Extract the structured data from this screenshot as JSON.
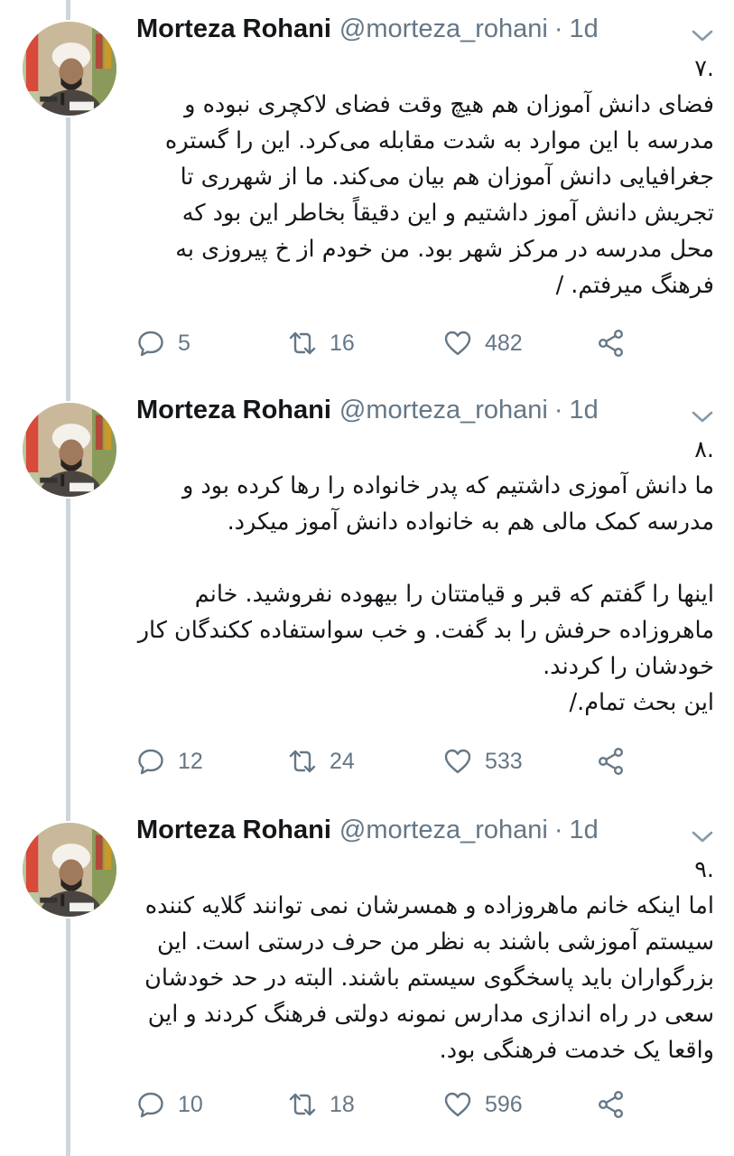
{
  "tweets": [
    {
      "author_name": "Morteza Rohani",
      "handle": "@morteza_rohani",
      "separator": "·",
      "time": "1d",
      "text": ".۷\nفضای دانش آموزان هم هیچ وقت فضای لاکچری نبوده و مدرسه با این موارد به شدت مقابله می‌کرد. این را گستره جغرافیایی دانش آموزان هم بیان می‌کند. ما از شهرری تا تجریش دانش آموز داشتیم و این دقیقاً بخاطر این بود که محل مدرسه در مرکز شهر بود. من خودم از خ پیروزی به فرهنگ میرفتم. /",
      "replies": "5",
      "retweets": "16",
      "likes": "482"
    },
    {
      "author_name": "Morteza Rohani",
      "handle": "@morteza_rohani",
      "separator": "·",
      "time": "1d",
      "text": ".۸\nما دانش آموزی داشتیم که پدر خانواده را رها کرده بود و مدرسه کمک مالی هم به خانواده دانش آموز میکرد.\n\nاینها را گفتم که قبر و قیامتتان را بیهوده نفروشید. خانم ماهروزاده حرفش را بد گفت. و خب سواستفاده ککندگان کار خودشان را کردند.\nاین بحث تمام./",
      "replies": "12",
      "retweets": "24",
      "likes": "533"
    },
    {
      "author_name": "Morteza Rohani",
      "handle": "@morteza_rohani",
      "separator": "·",
      "time": "1d",
      "text": ".۹\nاما اینکه خانم ماهروزاده و همسرشان نمی توانند گلایه کننده سیستم آموزشی باشند به نظر من حرف درستی است. این بزرگواران باید پاسخگوی سیستم باشند. البته در حد خودشان سعی در راه اندازی مدارس نمونه دولتی فرهنگ کردند و این واقعا یک خدمت فرهنگی بود.",
      "replies": "10",
      "retweets": "18",
      "likes": "596"
    }
  ],
  "colors": {
    "text": "#14171a",
    "secondary": "#657786",
    "thread_line": "#ccd6dd",
    "background": "#ffffff"
  },
  "icons": [
    "reply-icon",
    "retweet-icon",
    "like-icon",
    "share-icon",
    "chevron-down-icon"
  ]
}
